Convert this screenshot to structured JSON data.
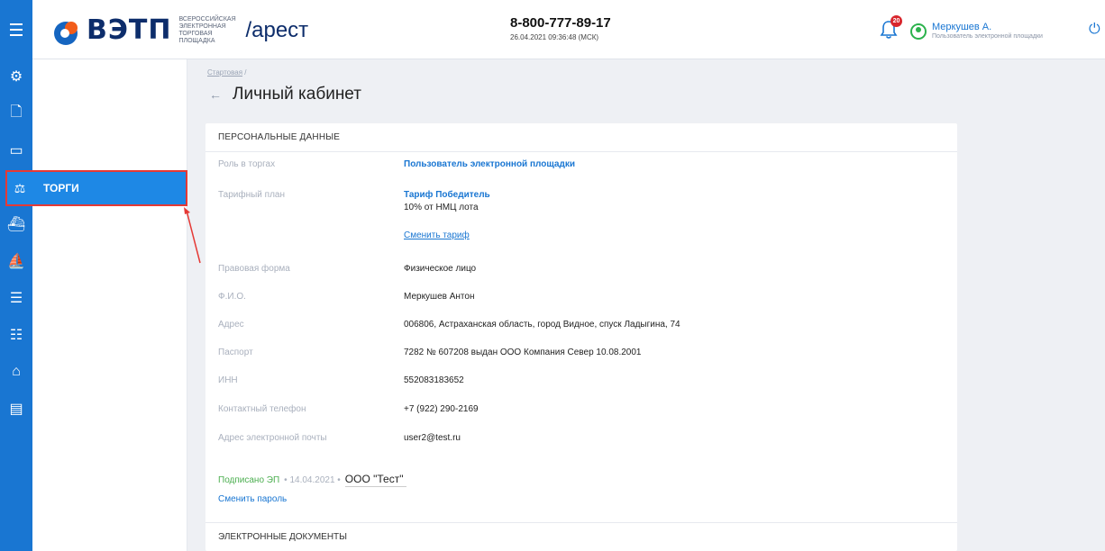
{
  "header": {
    "logo_text": "ВЭТП",
    "logo_subtitle": "ВСЕРОССИЙСКАЯ ЭЛЕКТРОННАЯ ТОРГОВАЯ ПЛОЩАДКА",
    "section_slug": "/арест",
    "phone": "8-800-777-89-17",
    "datetime": "26.04.2021 09:36:48 (МСК)",
    "notifications_count": "20",
    "user_name": "Меркушев А.",
    "user_role": "Пользователь электронной площадки"
  },
  "sidebar": {
    "icons": [
      "gear-icon",
      "document-icon",
      "card-icon",
      "auction-icon",
      "ship-icon",
      "ship-outline-icon",
      "list-icon",
      "tree-icon",
      "home-icon",
      "contacts-icon"
    ],
    "active_item_label": "ТОРГИ"
  },
  "breadcrumb": {
    "home_label": "Стартовая",
    "separator": "/"
  },
  "page": {
    "title": "Личный кабинет"
  },
  "personal": {
    "heading": "ПЕРСОНАЛЬНЫЕ ДАННЫЕ",
    "role_label": "Роль в торгах",
    "role_value": "Пользователь электронной площадки",
    "tariff_label": "Тарифный план",
    "tariff_name": "Тариф Победитель",
    "tariff_desc": "10% от НМЦ лота",
    "change_tariff": "Сменить тариф",
    "legal_form_label": "Правовая форма",
    "legal_form_value": "Физическое лицо",
    "fio_label": "Ф.И.О.",
    "fio_value": "Меркушев Антон",
    "address_label": "Адрес",
    "address_value": "006806, Астраханская область, город Видное, спуск Ладыгина, 74",
    "passport_label": "Паспорт",
    "passport_value": "7282 № 607208 выдан ООО Компания Север 10.08.2001",
    "inn_label": "ИНН",
    "inn_value": "552083183652",
    "phone_label": "Контактный телефон",
    "phone_value": "+7 (922) 290-2169",
    "email_label": "Адрес электронной почты",
    "email_value": "user2@test.ru",
    "signed_label": "Подписано ЭП",
    "signed_date": "• 14.04.2021 •",
    "signed_org": "ООО \"Тест\"",
    "change_password": "Сменить пароль"
  },
  "documents": {
    "heading": "ЭЛЕКТРОННЫЕ ДОКУМЕНТЫ"
  },
  "colors": {
    "accent": "#1976d2",
    "active_bg": "#1e88e5",
    "highlight_border": "#e53935",
    "signed_green": "#4caf50"
  }
}
